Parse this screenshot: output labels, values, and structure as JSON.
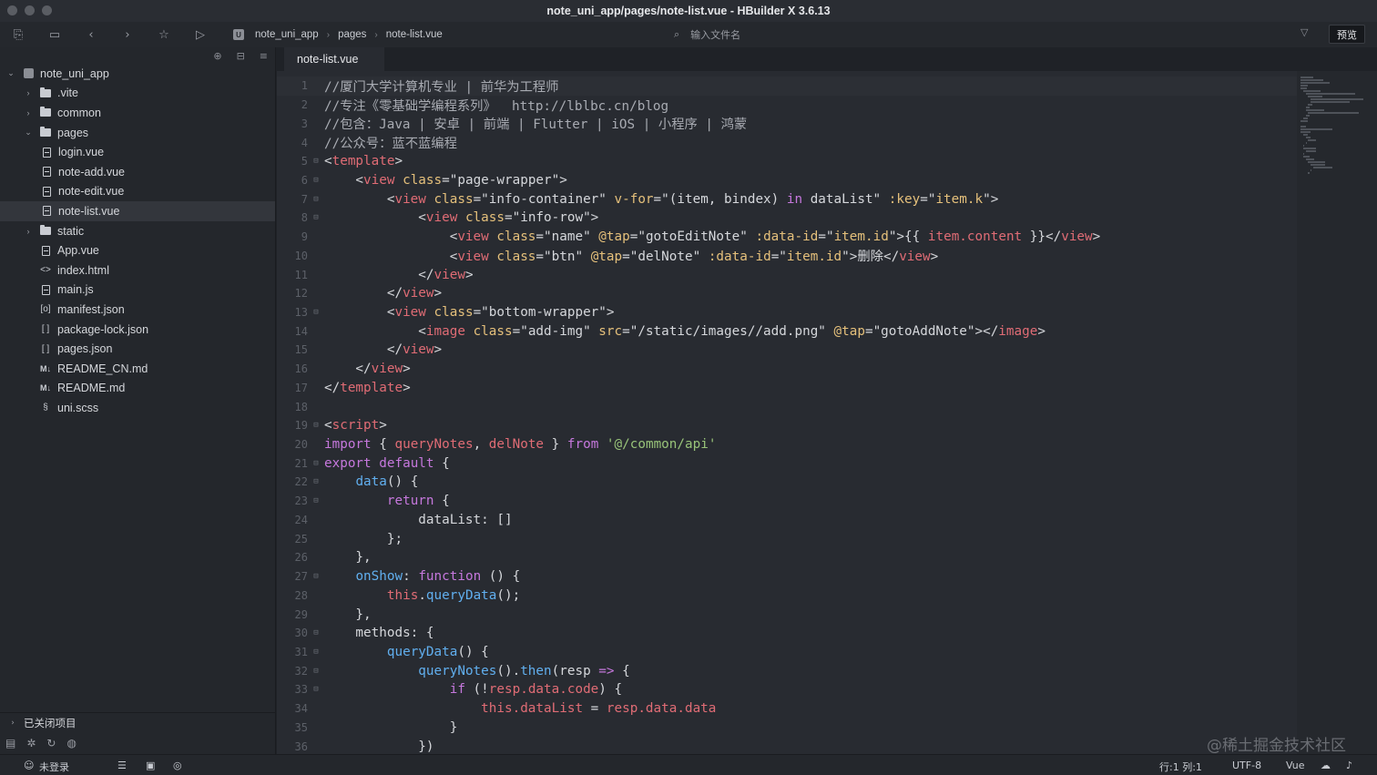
{
  "window": {
    "title": "note_uni_app/pages/note-list.vue - HBuilder X 3.6.13"
  },
  "toolbar": {
    "breadcrumb": [
      "note_uni_app",
      "pages",
      "note-list.vue"
    ],
    "file_search_placeholder": "输入文件名",
    "preview_label": "预览"
  },
  "sidebar": {
    "tree": [
      {
        "label": "note_uni_app",
        "indent": 0,
        "type": "project",
        "expanded": true
      },
      {
        "label": ".vite",
        "indent": 1,
        "type": "folder",
        "expanded": false
      },
      {
        "label": "common",
        "indent": 1,
        "type": "folder",
        "expanded": false
      },
      {
        "label": "pages",
        "indent": 1,
        "type": "folder-open",
        "expanded": true
      },
      {
        "label": "login.vue",
        "indent": 2,
        "type": "file"
      },
      {
        "label": "note-add.vue",
        "indent": 2,
        "type": "file"
      },
      {
        "label": "note-edit.vue",
        "indent": 2,
        "type": "file"
      },
      {
        "label": "note-list.vue",
        "indent": 2,
        "type": "file",
        "selected": true
      },
      {
        "label": "static",
        "indent": 1,
        "type": "folder",
        "expanded": false
      },
      {
        "label": "App.vue",
        "indent": 1,
        "type": "file"
      },
      {
        "label": "index.html",
        "indent": 1,
        "type": "html"
      },
      {
        "label": "main.js",
        "indent": 1,
        "type": "file"
      },
      {
        "label": "manifest.json",
        "indent": 1,
        "type": "json-obj"
      },
      {
        "label": "package-lock.json",
        "indent": 1,
        "type": "json"
      },
      {
        "label": "pages.json",
        "indent": 1,
        "type": "json"
      },
      {
        "label": "README_CN.md",
        "indent": 1,
        "type": "md"
      },
      {
        "label": "README.md",
        "indent": 1,
        "type": "md"
      },
      {
        "label": "uni.scss",
        "indent": 1,
        "type": "scss"
      }
    ],
    "closed_projects_label": "已关闭项目"
  },
  "editor": {
    "tab_label": "note-list.vue",
    "lines": [
      [
        [
          "t-cm",
          "//厦门大学计算机专业 | 前华为工程师"
        ]
      ],
      [
        [
          "t-cm",
          "//专注《零基础学编程系列》  http://lblbc.cn/blog"
        ]
      ],
      [
        [
          "t-cm",
          "//包含：Java | 安卓 | 前端 | Flutter | iOS | 小程序 | 鸿蒙"
        ]
      ],
      [
        [
          "t-cm",
          "//公众号：蓝不蓝编程"
        ]
      ],
      [
        [
          "t-str",
          "<"
        ],
        [
          "t-tag",
          "template"
        ],
        [
          "t-str",
          ">"
        ]
      ],
      [
        [
          "t-str",
          "    <"
        ],
        [
          "t-tag",
          "view"
        ],
        [
          "t-str",
          " "
        ],
        [
          "t-attr",
          "class"
        ],
        [
          "t-str",
          "=\"page-wrapper\">"
        ]
      ],
      [
        [
          "t-str",
          "        <"
        ],
        [
          "t-tag",
          "view"
        ],
        [
          "t-str",
          " "
        ],
        [
          "t-attr",
          "class"
        ],
        [
          "t-str",
          "=\"info-container\" "
        ],
        [
          "t-attr",
          "v-for"
        ],
        [
          "t-str",
          "=\"(item, bindex) "
        ],
        [
          "t-kw",
          "in"
        ],
        [
          "t-str",
          " dataList\" "
        ],
        [
          "t-attr",
          ":key"
        ],
        [
          "t-str",
          "=\""
        ],
        [
          "t-attr",
          "item.k"
        ],
        [
          "t-str",
          "\">"
        ]
      ],
      [
        [
          "t-str",
          "            <"
        ],
        [
          "t-tag",
          "view"
        ],
        [
          "t-str",
          " "
        ],
        [
          "t-attr",
          "class"
        ],
        [
          "t-str",
          "=\"info-row\">"
        ]
      ],
      [
        [
          "t-str",
          "                <"
        ],
        [
          "t-tag",
          "view"
        ],
        [
          "t-str",
          " "
        ],
        [
          "t-attr",
          "class"
        ],
        [
          "t-str",
          "=\"name\" "
        ],
        [
          "t-attr",
          "@tap"
        ],
        [
          "t-str",
          "=\"gotoEditNote\" "
        ],
        [
          "t-attr",
          ":data-id"
        ],
        [
          "t-str",
          "=\""
        ],
        [
          "t-attr",
          "item.id"
        ],
        [
          "t-str",
          "\">{{ "
        ],
        [
          "t-var",
          "item.content"
        ],
        [
          "t-str",
          " }}</"
        ],
        [
          "t-tag",
          "view"
        ],
        [
          "t-str",
          ">"
        ]
      ],
      [
        [
          "t-str",
          "                <"
        ],
        [
          "t-tag",
          "view"
        ],
        [
          "t-str",
          " "
        ],
        [
          "t-attr",
          "class"
        ],
        [
          "t-str",
          "=\"btn\" "
        ],
        [
          "t-attr",
          "@tap"
        ],
        [
          "t-str",
          "=\"delNote\" "
        ],
        [
          "t-attr",
          ":data-id"
        ],
        [
          "t-str",
          "=\""
        ],
        [
          "t-attr",
          "item.id"
        ],
        [
          "t-str",
          "\">删除</"
        ],
        [
          "t-tag",
          "view"
        ],
        [
          "t-str",
          ">"
        ]
      ],
      [
        [
          "t-str",
          "            </"
        ],
        [
          "t-tag",
          "view"
        ],
        [
          "t-str",
          ">"
        ]
      ],
      [
        [
          "t-str",
          "        </"
        ],
        [
          "t-tag",
          "view"
        ],
        [
          "t-str",
          ">"
        ]
      ],
      [
        [
          "t-str",
          "        <"
        ],
        [
          "t-tag",
          "view"
        ],
        [
          "t-str",
          " "
        ],
        [
          "t-attr",
          "class"
        ],
        [
          "t-str",
          "=\"bottom-wrapper\">"
        ]
      ],
      [
        [
          "t-str",
          "            <"
        ],
        [
          "t-tag",
          "image"
        ],
        [
          "t-str",
          " "
        ],
        [
          "t-attr",
          "class"
        ],
        [
          "t-str",
          "=\"add-img\" "
        ],
        [
          "t-attr",
          "src"
        ],
        [
          "t-str",
          "=\"/static/images//add.png\" "
        ],
        [
          "t-attr",
          "@tap"
        ],
        [
          "t-str",
          "=\"gotoAddNote\"></"
        ],
        [
          "t-tag",
          "image"
        ],
        [
          "t-str",
          ">"
        ]
      ],
      [
        [
          "t-str",
          "        </"
        ],
        [
          "t-tag",
          "view"
        ],
        [
          "t-str",
          ">"
        ]
      ],
      [
        [
          "t-str",
          "    </"
        ],
        [
          "t-tag",
          "view"
        ],
        [
          "t-str",
          ">"
        ]
      ],
      [
        [
          "t-str",
          "</"
        ],
        [
          "t-tag",
          "template"
        ],
        [
          "t-str",
          ">"
        ]
      ],
      [],
      [
        [
          "t-str",
          "<"
        ],
        [
          "t-tag",
          "script"
        ],
        [
          "t-str",
          ">"
        ]
      ],
      [
        [
          "t-kw",
          "import"
        ],
        [
          "t-str",
          " { "
        ],
        [
          "t-var",
          "queryNotes"
        ],
        [
          "t-str",
          ", "
        ],
        [
          "t-var",
          "delNote"
        ],
        [
          "t-str",
          " } "
        ],
        [
          "t-kw",
          "from"
        ],
        [
          "t-str",
          " "
        ],
        [
          "t-lit",
          "'@/common/api'"
        ]
      ],
      [
        [
          "t-kw",
          "export"
        ],
        [
          "t-str",
          " "
        ],
        [
          "t-kw",
          "default"
        ],
        [
          "t-str",
          " {"
        ]
      ],
      [
        [
          "t-str",
          "    "
        ],
        [
          "t-fn",
          "data"
        ],
        [
          "t-str",
          "() {"
        ]
      ],
      [
        [
          "t-str",
          "        "
        ],
        [
          "t-kw",
          "return"
        ],
        [
          "t-str",
          " {"
        ]
      ],
      [
        [
          "t-str",
          "            dataList: []"
        ]
      ],
      [
        [
          "t-str",
          "        };"
        ]
      ],
      [
        [
          "t-str",
          "    },"
        ]
      ],
      [
        [
          "t-str",
          "    "
        ],
        [
          "t-fn",
          "onShow"
        ],
        [
          "t-str",
          ": "
        ],
        [
          "t-kw",
          "function"
        ],
        [
          "t-str",
          " () {"
        ]
      ],
      [
        [
          "t-str",
          "        "
        ],
        [
          "t-var",
          "this"
        ],
        [
          "t-str",
          "."
        ],
        [
          "t-fn",
          "queryData"
        ],
        [
          "t-str",
          "();"
        ]
      ],
      [
        [
          "t-str",
          "    },"
        ]
      ],
      [
        [
          "t-str",
          "    methods: {"
        ]
      ],
      [
        [
          "t-str",
          "        "
        ],
        [
          "t-fn",
          "queryData"
        ],
        [
          "t-str",
          "() {"
        ]
      ],
      [
        [
          "t-str",
          "            "
        ],
        [
          "t-fn",
          "queryNotes"
        ],
        [
          "t-str",
          "()."
        ],
        [
          "t-fn",
          "then"
        ],
        [
          "t-str",
          "(resp "
        ],
        [
          "t-kw",
          "=>"
        ],
        [
          "t-str",
          " {"
        ]
      ],
      [
        [
          "t-str",
          "                "
        ],
        [
          "t-kw",
          "if"
        ],
        [
          "t-str",
          " (!"
        ],
        [
          "t-var",
          "resp.data.code"
        ],
        [
          "t-str",
          ") {"
        ]
      ],
      [
        [
          "t-str",
          "                    "
        ],
        [
          "t-var",
          "this.dataList"
        ],
        [
          "t-str",
          " = "
        ],
        [
          "t-var",
          "resp.data.data"
        ]
      ],
      [
        [
          "t-str",
          "                }"
        ]
      ],
      [
        [
          "t-str",
          "            })"
        ]
      ]
    ],
    "fold_lines": [
      5,
      6,
      7,
      8,
      13,
      19,
      21,
      22,
      23,
      27,
      30,
      31,
      32,
      33
    ]
  },
  "watermark": "@稀土掘金技术社区",
  "statusbar": {
    "login_label": "未登录",
    "position": "行:1  列:1",
    "encoding": "UTF-8",
    "language": "Vue"
  },
  "colors": {
    "background": "#282b31",
    "comment": "#a8abb2",
    "tag": "#e06c75",
    "attribute": "#e5c07b",
    "keyword": "#c678dd",
    "function": "#61afef",
    "string_literal": "#98c379"
  }
}
